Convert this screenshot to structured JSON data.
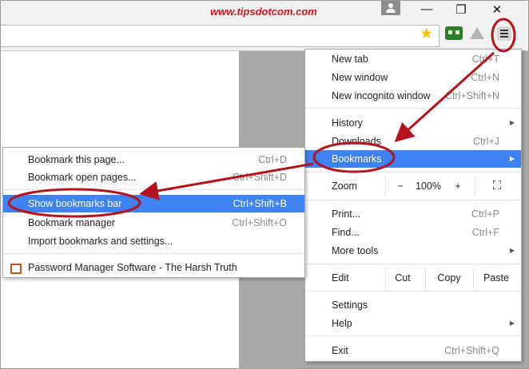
{
  "watermark": "www.tipsdotcom.com",
  "window_controls": {
    "minimize": "—",
    "restore": "❐",
    "close": "✕"
  },
  "toolbar": {
    "star_icon": "★"
  },
  "main_menu": {
    "new_tab": {
      "label": "New tab",
      "shortcut": "Ctrl+T"
    },
    "new_window": {
      "label": "New window",
      "shortcut": "Ctrl+N"
    },
    "new_incognito": {
      "label": "New incognito window",
      "shortcut": "Ctrl+Shift+N"
    },
    "history": {
      "label": "History",
      "arrow": "▶"
    },
    "downloads": {
      "label": "Downloads",
      "shortcut": "Ctrl+J"
    },
    "bookmarks": {
      "label": "Bookmarks",
      "arrow": "▶"
    },
    "zoom": {
      "label": "Zoom",
      "minus": "−",
      "value": "100%",
      "plus": "+",
      "fullscreen": "⛶"
    },
    "print": {
      "label": "Print...",
      "shortcut": "Ctrl+P"
    },
    "find": {
      "label": "Find...",
      "shortcut": "Ctrl+F"
    },
    "more_tools": {
      "label": "More tools",
      "arrow": "▶"
    },
    "edit": {
      "label": "Edit",
      "cut": "Cut",
      "copy": "Copy",
      "paste": "Paste"
    },
    "settings": {
      "label": "Settings"
    },
    "help": {
      "label": "Help",
      "arrow": "▶"
    },
    "exit": {
      "label": "Exit",
      "shortcut": "Ctrl+Shift+Q"
    }
  },
  "bookmarks_menu": {
    "bookmark_page": {
      "label": "Bookmark this page...",
      "shortcut": "Ctrl+D"
    },
    "bookmark_open_pages": {
      "label": "Bookmark open pages...",
      "shortcut": "Ctrl+Shift+D"
    },
    "show_bookmarks_bar": {
      "label": "Show bookmarks bar",
      "shortcut": "Ctrl+Shift+B"
    },
    "bookmark_manager": {
      "label": "Bookmark manager",
      "shortcut": "Ctrl+Shift+O"
    },
    "import_bookmarks": {
      "label": "Import bookmarks and settings..."
    },
    "saved_bookmark": {
      "label": "Password Manager Software - The Harsh Truth"
    }
  },
  "colors": {
    "highlight": "#3f82f2",
    "annotation": "#b5121b",
    "watermark": "#d1141c"
  }
}
